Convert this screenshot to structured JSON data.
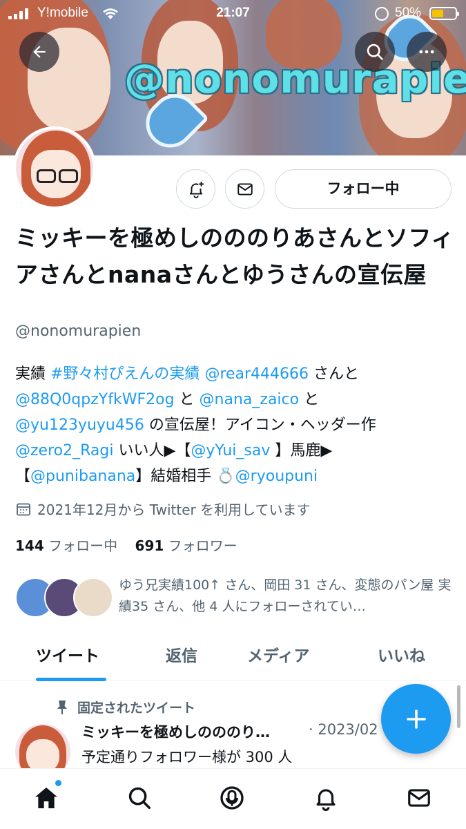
{
  "status_bar": {
    "carrier": "Y!mobile",
    "time": "21:07",
    "battery_percent": "50%",
    "battery_level": 0.5
  },
  "banner": {
    "watermark_text": "@nonomurapien"
  },
  "profile": {
    "follow_button_label": "フォロー中",
    "display_name": "ミッキーを極めしのののりあさんとソフィアさんとnanaさんとゆうさんの宣伝屋",
    "handle": "@nonomurapien",
    "bio": {
      "line1_prefix": "実績 ",
      "hashtag": "#野々村ぴえんの実績",
      "mention1": "@rear444666",
      "text_san_to": " さんと",
      "mention2": "@88Q0qpzYfkWF2og",
      "text_to": " と ",
      "mention3": "@nana_zaico",
      "text_to2": " と",
      "mention4": "@yu123yuyu456",
      "text_senden": " の宣伝屋！アイコン・ヘッダー作",
      "mention5": "@zero2_Ragi",
      "text_iihito": " いい人▶︎【",
      "mention6": "@yYui_sav",
      "text_baka": " 】馬鹿▶︎",
      "text_bracket_open": "【",
      "mention7": "@punibanana",
      "text_kekkon": "】結婚相手 💍",
      "mention8": "@ryoupuni"
    },
    "joined": "2021年12月から Twitter を利用しています",
    "following_count": "144",
    "following_label": "フォロー中",
    "followers_count": "691",
    "followers_label": "フォロワー",
    "mutuals_text": "ゆう兄実績100↑ さん、岡田 31 さん、変態のパン屋 実績35 さん、他 4 人にフォローされてい…"
  },
  "tabs": [
    {
      "label": "ツイート",
      "active": true
    },
    {
      "label": "返信",
      "active": false
    },
    {
      "label": "メディア",
      "active": false
    },
    {
      "label": "いいね",
      "active": false
    }
  ],
  "pinned_tweet": {
    "pinned_label": "固定されたツイート",
    "author": "ミッキーを極めしのののり…",
    "date": "· 2023/02",
    "text": "予定通りフォロワー様が 300 人"
  },
  "colors": {
    "accent": "#1d9bf0",
    "text_primary": "#0f1419",
    "text_secondary": "#536471"
  },
  "icons": {
    "back": "arrow-left-icon",
    "search": "search-icon",
    "more": "more-horizontal-icon",
    "notify": "bell-plus-icon",
    "message": "envelope-icon",
    "calendar": "calendar-icon",
    "pin": "pin-icon",
    "compose": "plus-icon",
    "nav": [
      "home-icon",
      "search-icon",
      "spaces-icon",
      "bell-icon",
      "envelope-icon"
    ]
  }
}
